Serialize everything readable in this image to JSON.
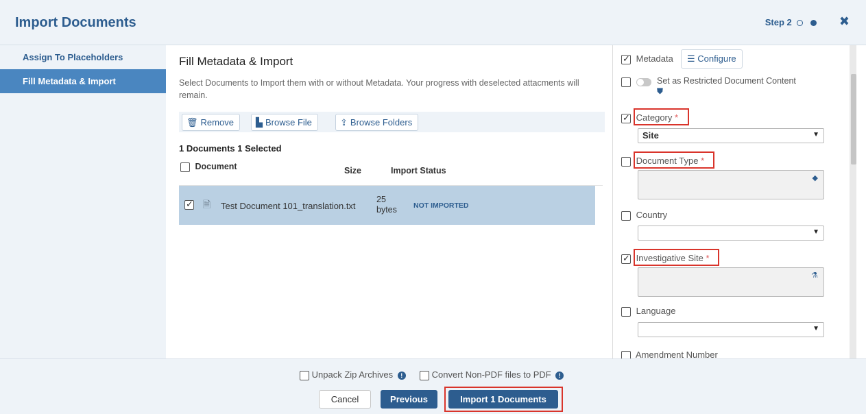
{
  "header": {
    "title": "Import Documents",
    "step_label": "Step 2",
    "close_icon": "close-icon"
  },
  "nav": {
    "items": [
      {
        "label": "Assign To Placeholders",
        "active": false
      },
      {
        "label": "Fill Metadata & Import",
        "active": true
      }
    ]
  },
  "main": {
    "title": "Fill Metadata & Import",
    "description": "Select Documents to Import them with or without Metadata. Your progress with deselected attacments will remain.",
    "toolbar": {
      "remove": "Remove",
      "browse_file": "Browse File",
      "browse_folders": "Browse Folders"
    },
    "counts": "1 Documents 1 Selected",
    "columns": {
      "document": "Document",
      "size": "Size",
      "status": "Import Status"
    },
    "rows": [
      {
        "name": "Test Document 101_translation.txt",
        "size_value": "25",
        "size_unit": "bytes",
        "status": "NOT IMPORTED",
        "checked": true
      }
    ]
  },
  "metadata": {
    "metadata_label": "Metadata",
    "configure_label": "Configure",
    "restricted_label": "Set as Restricted Document Content",
    "category": {
      "label": "Category",
      "required": "*",
      "value": "Site"
    },
    "document_type": {
      "label": "Document Type",
      "required": "*"
    },
    "country": {
      "label": "Country",
      "value": ""
    },
    "investigative_site": {
      "label": "Investigative Site",
      "required": "*"
    },
    "language": {
      "label": "Language",
      "value": ""
    },
    "amendment_number": {
      "label": "Amendment Number"
    }
  },
  "footer": {
    "unpack_label": "Unpack Zip Archives",
    "convert_label": "Convert Non-PDF files to PDF",
    "cancel": "Cancel",
    "previous": "Previous",
    "import": "Import 1 Documents"
  },
  "colors": {
    "primary": "#2d5d8f",
    "nav_active": "#4a86c0",
    "row_selected": "#bad0e3",
    "highlight": "#d9342b",
    "required": "#e05a5a"
  }
}
